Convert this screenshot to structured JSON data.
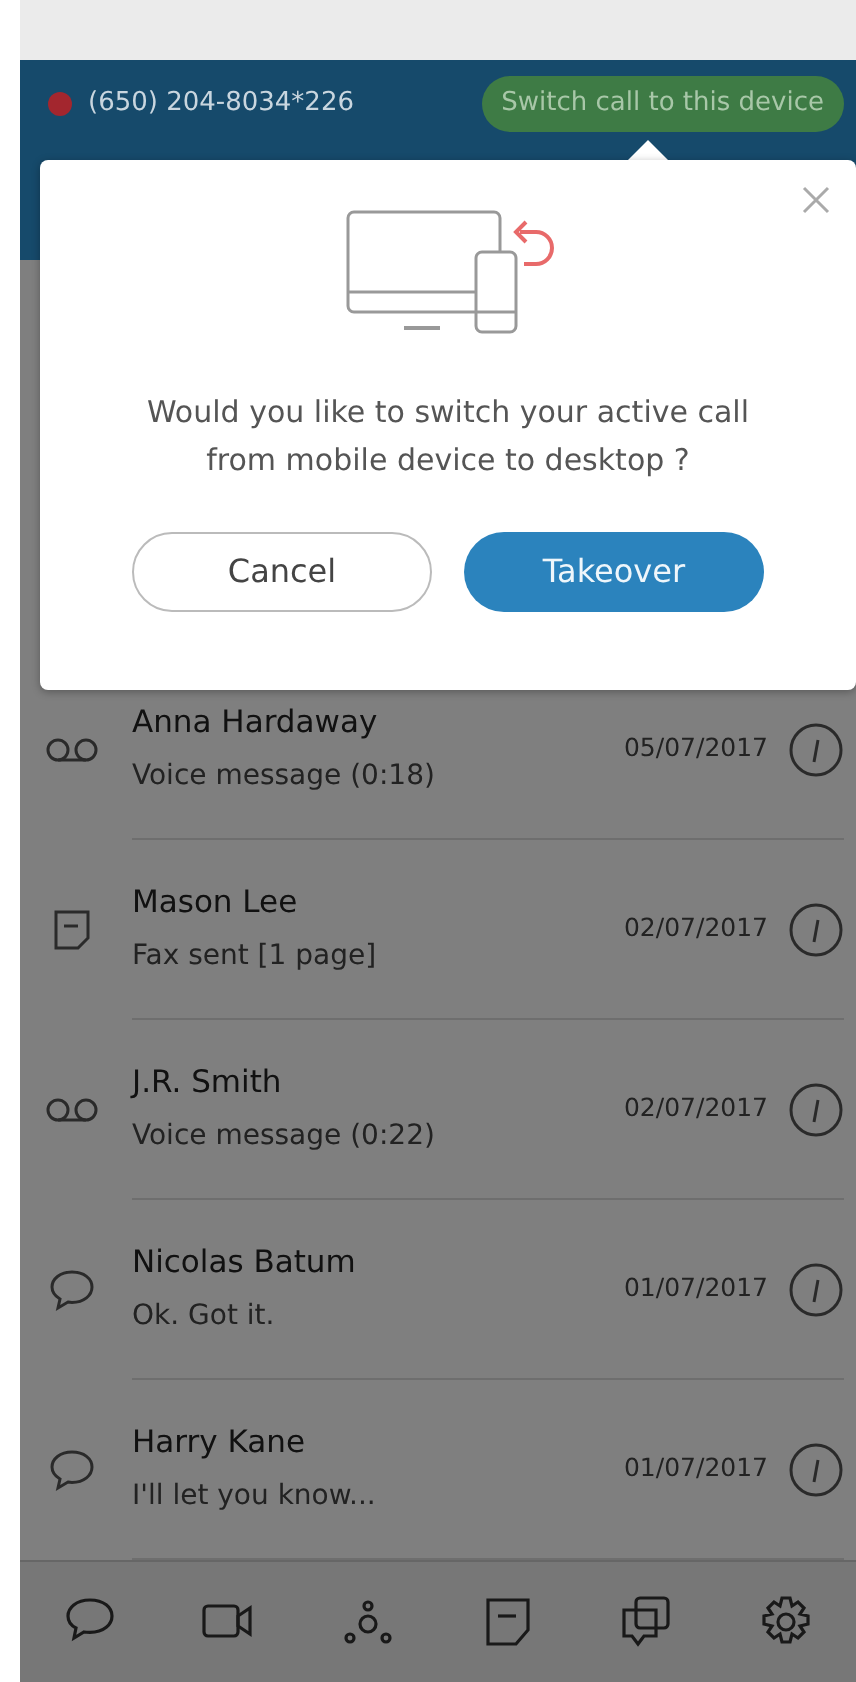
{
  "header": {
    "phone": "(650) 204-8034*226",
    "switch_button": "Switch call to this device"
  },
  "dialog": {
    "message": "Would you like to switch your active call from mobile device to desktop ?",
    "buttons": [
      {
        "label": "Cancel",
        "kind": "secondary"
      },
      {
        "label": "Takeover",
        "kind": "primary"
      }
    ]
  },
  "list": [
    {
      "kind": "voicemail",
      "name": "Anna Hardaway",
      "detail": "Voice message (0:18)",
      "date": "05/07/2017"
    },
    {
      "kind": "fax",
      "name": "Mason Lee",
      "detail": "Fax sent [1 page]",
      "date": "02/07/2017"
    },
    {
      "kind": "voicemail",
      "name": "J.R. Smith",
      "detail": "Voice message (0:22)",
      "date": "02/07/2017"
    },
    {
      "kind": "message",
      "name": "Nicolas Batum",
      "detail": "Ok. Got it.",
      "date": "01/07/2017"
    },
    {
      "kind": "message",
      "name": "Harry Kane",
      "detail": "I'll let you know...",
      "date": "01/07/2017"
    }
  ]
}
